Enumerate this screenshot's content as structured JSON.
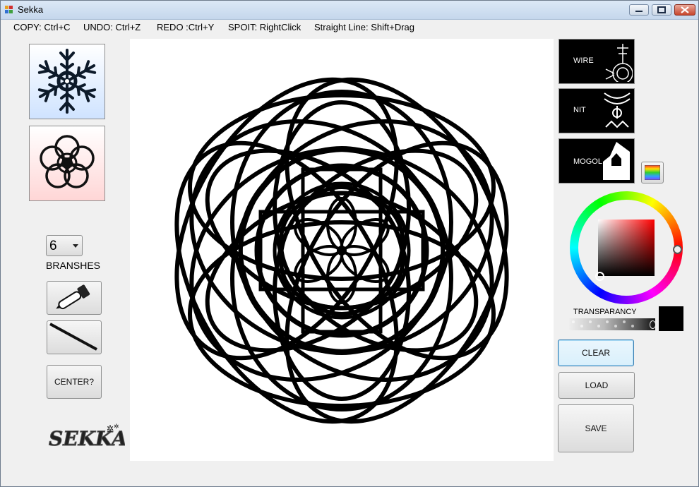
{
  "window": {
    "title": "Sekka"
  },
  "shortcuts": [
    "COPY: Ctrl+C",
    "UNDO: Ctrl+Z",
    "REDO :Ctrl+Y",
    "SPOIT: RightClick",
    "Straight Line: Shift+Drag"
  ],
  "left_panel": {
    "branches_value": "6",
    "branches_label": "BRANSHES",
    "center_button": "CENTER?",
    "logo_text": "SEKKA"
  },
  "right_panel": {
    "modes": [
      "WIRE",
      "NIT",
      "MOGOL"
    ],
    "transparency_label": "TRANSPARANCY",
    "clear_button": "CLEAR",
    "load_button": "LOAD",
    "save_button": "SAVE",
    "current_color": "#000000"
  }
}
